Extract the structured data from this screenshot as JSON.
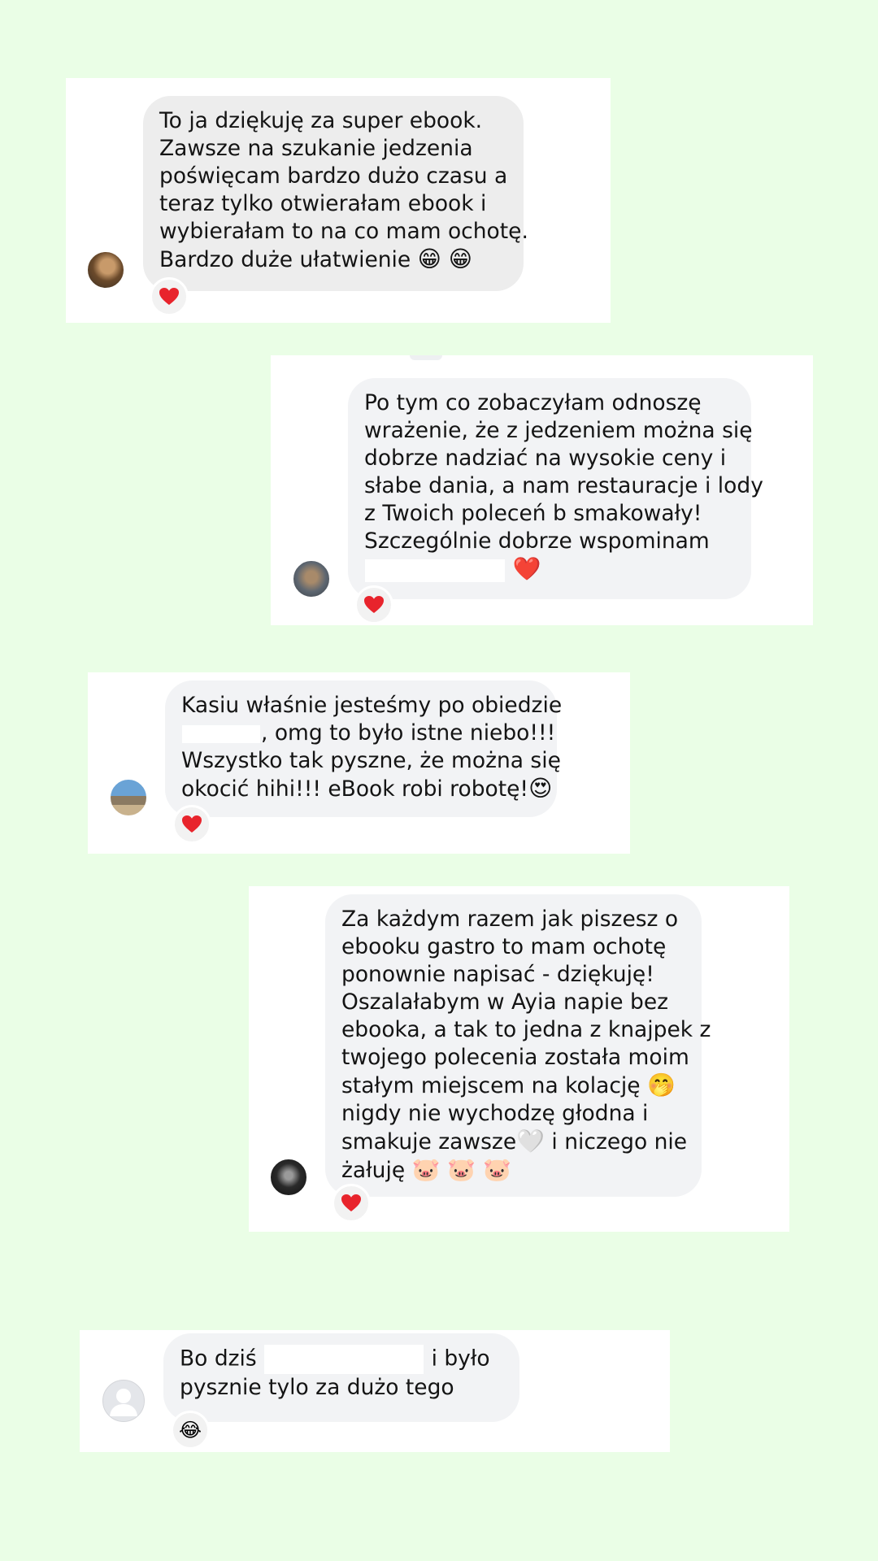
{
  "theme": {
    "background": "#eafee6",
    "card": "#ffffff",
    "bubble_gray": "#ededed",
    "bubble_light": "#f2f3f5",
    "heart_red": "#e8242c"
  },
  "messages": [
    {
      "lines": [
        "To ja dziękuję za super ebook.",
        "Zawsze na szukanie jedzenia",
        "poświęcam bardzo dużo czasu a",
        "teraz tylko otwierałam ebook i",
        "wybierałam to na co mam ochotę.",
        "Bardzo duże ułatwienie"
      ],
      "end_emoji": "😁 😁",
      "reaction": "heart-icon"
    },
    {
      "lines": [
        "Po tym co zobaczyłam odnoszę",
        "wrażenie, że z jedzeniem można się",
        "dobrze nadziać na wysokie ceny i",
        "słabe dania, a nam restauracje i lody",
        "z Twoich poleceń b smakowały!",
        "Szczególnie dobrze wspominam"
      ],
      "end_emoji": "❤️",
      "reaction": "heart-icon"
    },
    {
      "line1": "Kasiu właśnie jesteśmy po obiedzie",
      "line2_after": ", omg to było istne niebo!!!",
      "line3": "Wszystko tak pyszne, że można się",
      "line4": "okocić hihi!!! eBook robi robotę!",
      "end_emoji": "😍",
      "reaction": "heart-icon"
    },
    {
      "lines": [
        "Za każdym razem jak piszesz o",
        "ebooku gastro to mam ochotę",
        "ponownie napisać - dziękuję!",
        "Oszalałabym w Ayia napie bez",
        "ebooka, a tak to jedna z knajpek z",
        "twojego polecenia została moim"
      ],
      "line7": "stałym miejscem na kolację",
      "line7_emoji": "🤭",
      "line8": "nigdy nie wychodzę głodna i",
      "line9_a": "smakuje zawsze",
      "line9_emoji": "🤍",
      "line9_b": " i niczego nie",
      "line10": "żałuję",
      "line10_emoji": "🐷 🐷 🐷",
      "reaction": "heart-icon"
    },
    {
      "line1_a": "Bo dziś ",
      "line1_b": " i było",
      "line2": "pysznie tylo za dużo tego",
      "reaction": "laughing-tears-icon",
      "reaction_emoji": "😂"
    }
  ]
}
